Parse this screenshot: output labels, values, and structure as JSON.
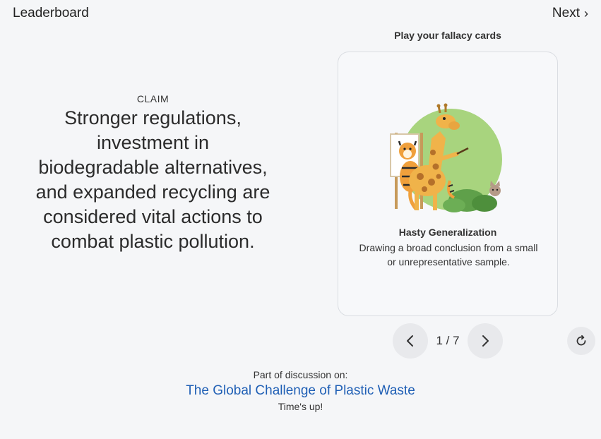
{
  "header": {
    "leaderboard_label": "Leaderboard",
    "next_label": "Next",
    "next_chevron": "›"
  },
  "claim": {
    "label": "CLAIM",
    "text": "Stronger regulations, investment in biodegradable alternatives, and expanded recycling are considered vital actions to combat plastic pollution."
  },
  "cards": {
    "heading": "Play your fallacy cards",
    "current": {
      "title": "Hasty Generalization",
      "description": "Drawing a broad conclusion from a small or unrepresentative sample.",
      "illustration": "giraffe-painting-tiger-illustration"
    },
    "pager": {
      "counter": "1 / 7",
      "prev_icon": "chevron-left-icon",
      "next_icon": "chevron-right-icon"
    },
    "reset_icon": "refresh-icon"
  },
  "footer": {
    "label": "Part of discussion on:",
    "discussion_title": "The Global Challenge of Plastic Waste",
    "status": "Time's up!"
  },
  "colors": {
    "background": "#f5f6f8",
    "link": "#1f5fb5",
    "button_bg": "#e8e9ec",
    "card_border": "#dadde2",
    "art_green": "#a8d47e"
  }
}
